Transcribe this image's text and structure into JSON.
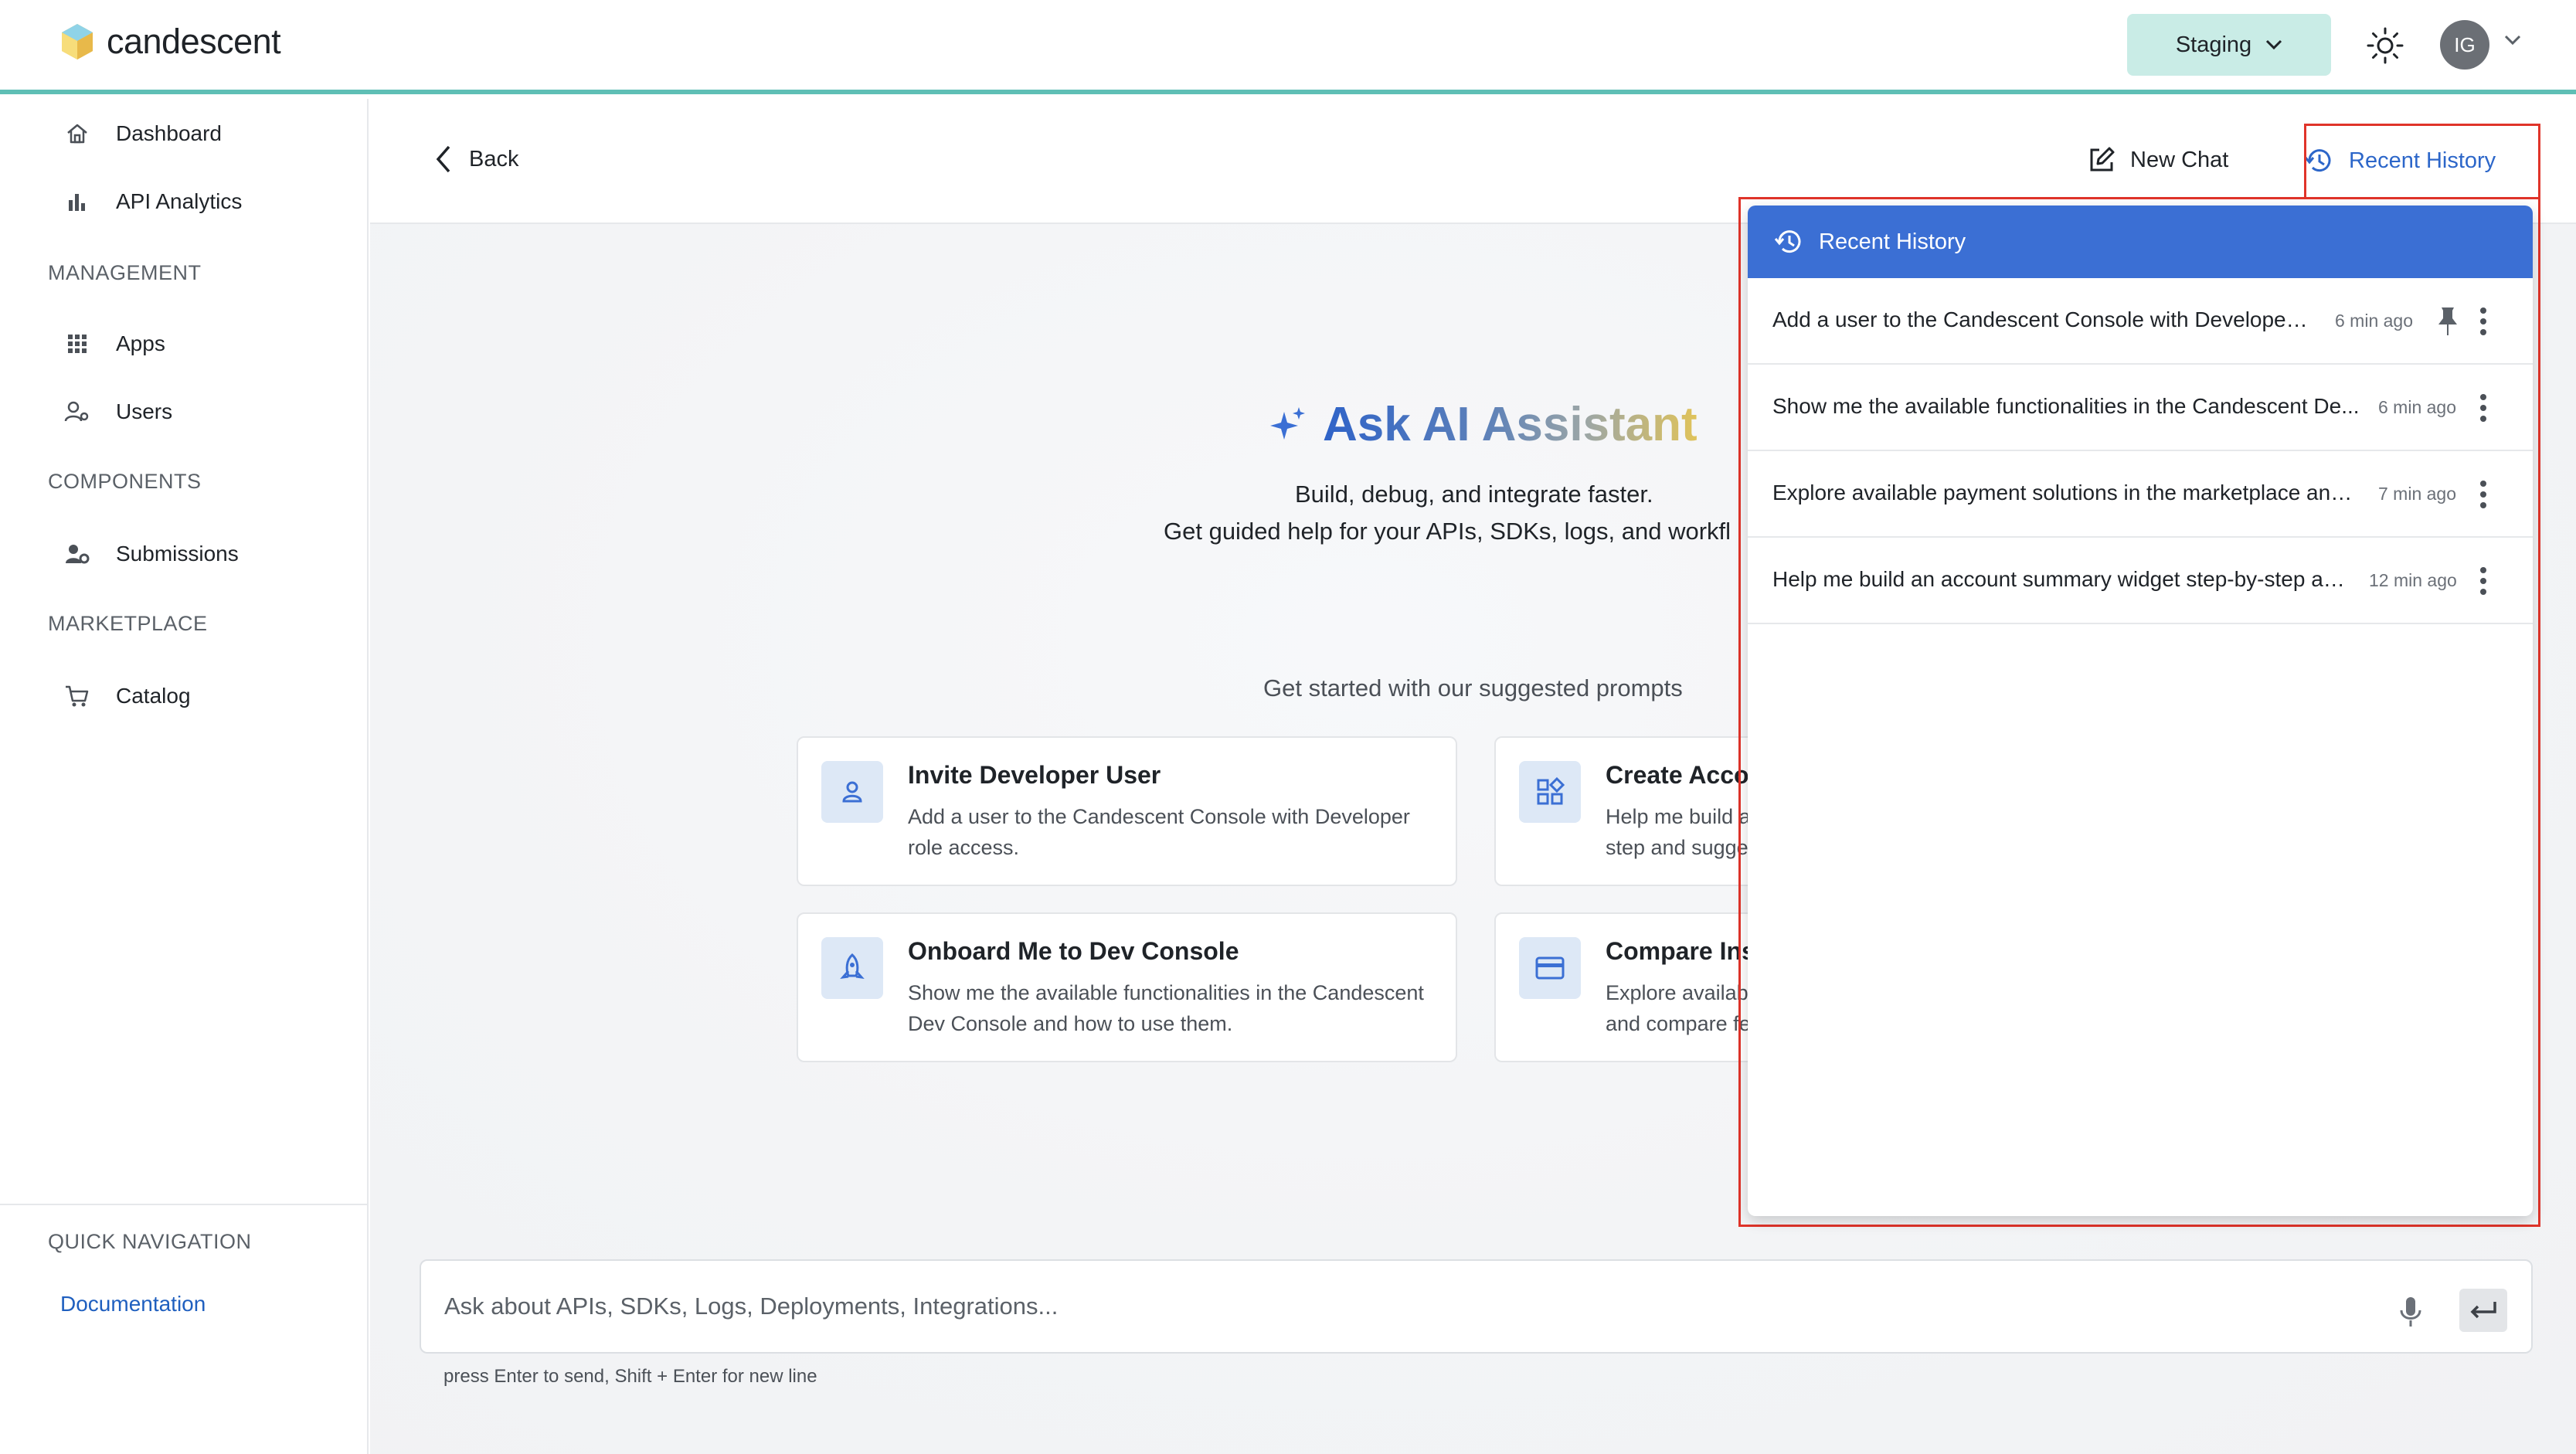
{
  "header": {
    "brand": "candescent",
    "environment": "Staging",
    "avatar_initials": "IG"
  },
  "sidebar": {
    "items_top": [
      {
        "label": "Dashboard",
        "icon": "home-icon"
      },
      {
        "label": "API Analytics",
        "icon": "bar-chart-icon"
      }
    ],
    "sections": {
      "management": "MANAGEMENT",
      "components": "COMPONENTS",
      "marketplace": "MARKETPLACE",
      "quick_navigation": "QUICK NAVIGATION"
    },
    "management_items": [
      {
        "label": "Apps",
        "icon": "grid-icon"
      },
      {
        "label": "Users",
        "icon": "users-gear-icon"
      }
    ],
    "components_items": [
      {
        "label": "Submissions",
        "icon": "user-gear-icon"
      }
    ],
    "marketplace_items": [
      {
        "label": "Catalog",
        "icon": "cart-icon"
      }
    ],
    "quick_links": [
      {
        "label": "Documentation"
      }
    ]
  },
  "main": {
    "back_label": "Back",
    "new_chat_label": "New Chat",
    "recent_history_label": "Recent History",
    "hero_title": "Ask AI Assistant",
    "hero_subtitle_1": "Build, debug, and integrate faster.",
    "hero_subtitle_2": "Get guided help for your APIs, SDKs, logs, and workfl",
    "suggested_label": "Get started with our suggested prompts",
    "cards": [
      {
        "title": "Invite Developer User",
        "description": "Add a user to the Candescent Console with Developer role access.",
        "icon": "user-icon"
      },
      {
        "title": "Create Acco",
        "description": "Help me build a step and sugge",
        "icon": "widgets-icon"
      },
      {
        "title": "Onboard Me to Dev Console",
        "description": "Show me the available functionalities in the Candescent Dev Console and how to use them.",
        "icon": "rocket-icon"
      },
      {
        "title": "Compare Ins",
        "description": "Explore availab and compare fe",
        "icon": "credit-card-icon"
      }
    ],
    "input_placeholder": "Ask about APIs, SDKs, Logs, Deployments, Integrations...",
    "hint": "press Enter to send, Shift + Enter for new line"
  },
  "history_panel": {
    "title": "Recent History",
    "items": [
      {
        "text": "Add a user to the Candescent Console with Developer ...",
        "time": "6 min ago",
        "pinned": true
      },
      {
        "text": "Show me the available functionalities in the Candescent De...",
        "time": "6 min ago",
        "pinned": false
      },
      {
        "text": "Explore available payment solutions in the marketplace and...",
        "time": "7 min ago",
        "pinned": false
      },
      {
        "text": "Help me build an account summary widget step-by-step an...",
        "time": "12 min ago",
        "pinned": false
      }
    ]
  },
  "colors": {
    "accent_blue": "#3b6fd4",
    "header_teal": "#5fbfb5",
    "staging_bg": "#c9ece6",
    "highlight_red": "#e0342a"
  }
}
